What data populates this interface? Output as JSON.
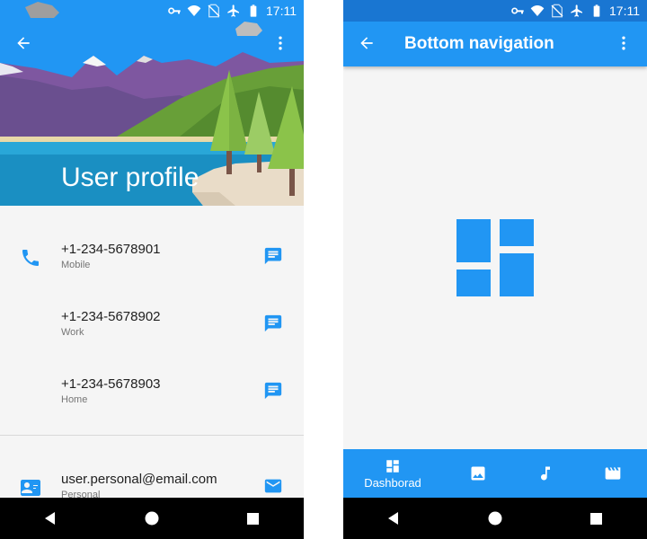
{
  "colors": {
    "primary": "#2196f3",
    "status_bar_dark": "#1976d2",
    "nav_bar": "#000000",
    "text_primary": "#212121",
    "text_secondary": "#757575"
  },
  "status_bar": {
    "time": "17:11",
    "icons": [
      "vpn-key-icon",
      "wifi-icon",
      "no-sim-icon",
      "airplane-icon",
      "battery-icon"
    ]
  },
  "left_screen": {
    "title": "User profile",
    "toolbar_icons": [
      "back-arrow-icon",
      "more-vert-icon"
    ],
    "contacts": [
      {
        "value": "+1-234-5678901",
        "type": "Mobile",
        "lead_icon": "phone-icon",
        "action_icon": "message-icon"
      },
      {
        "value": "+1-234-5678902",
        "type": "Work",
        "lead_icon": "",
        "action_icon": "message-icon"
      },
      {
        "value": "+1-234-5678903",
        "type": "Home",
        "lead_icon": "",
        "action_icon": "message-icon"
      },
      {
        "value": "user.personal@email.com",
        "type": "Personal",
        "lead_icon": "contact-card-icon",
        "action_icon": "email-icon"
      }
    ]
  },
  "right_screen": {
    "title": "Bottom navigation",
    "content_icon": "dashboard-icon",
    "bottom_nav": [
      {
        "label": "Dashborad",
        "icon": "dashboard-icon",
        "active": true
      },
      {
        "label": "",
        "icon": "image-icon",
        "active": false
      },
      {
        "label": "",
        "icon": "music-note-icon",
        "active": false
      },
      {
        "label": "",
        "icon": "movie-icon",
        "active": false
      }
    ]
  },
  "system_nav": [
    "back-triangle-icon",
    "home-circle-icon",
    "recents-square-icon"
  ]
}
